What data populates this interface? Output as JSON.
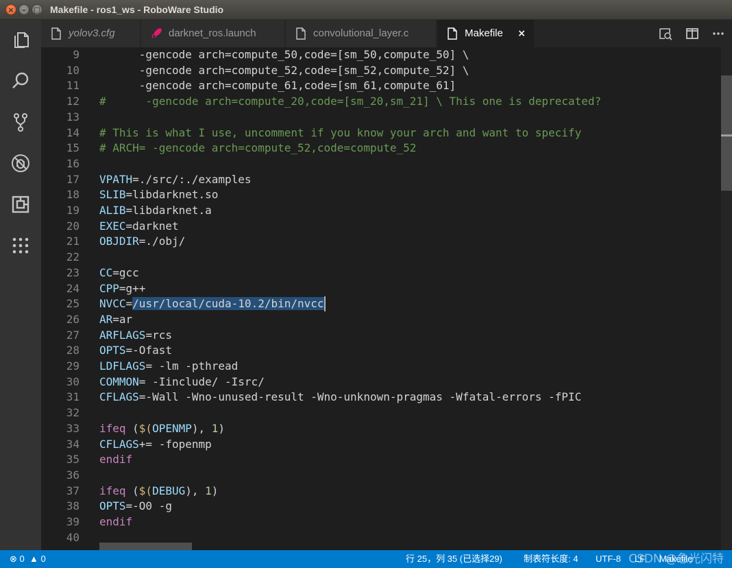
{
  "window": {
    "title": "Makefile - ros1_ws - RoboWare Studio",
    "close_glyph": "×",
    "min_glyph": "–",
    "max_glyph": "□"
  },
  "activity_icons": [
    "files-icon",
    "search-icon",
    "source-control-icon",
    "debug-icon",
    "extensions-icon",
    "apps-icon"
  ],
  "tabs": [
    {
      "label": "yolov3.cfg",
      "icon": "file-icon",
      "italic": true
    },
    {
      "label": "darknet_ros.launch",
      "icon": "rocket-icon",
      "italic": false
    },
    {
      "label": "convolutional_layer.c",
      "icon": "file-icon",
      "italic": false
    },
    {
      "label": "Makefile",
      "icon": "file-icon",
      "italic": false,
      "active": true,
      "close": "×"
    }
  ],
  "tab_actions": [
    "open-preview-icon",
    "split-editor-icon",
    "more-actions-icon"
  ],
  "editor": {
    "lines": [
      {
        "n": "9",
        "tokens": [
          [
            "      -gencode arch=compute_50,code=[sm_50,compute_50] \\",
            ""
          ]
        ]
      },
      {
        "n": "10",
        "tokens": [
          [
            "      -gencode arch=compute_52,code=[sm_52,compute_52] \\",
            ""
          ]
        ]
      },
      {
        "n": "11",
        "tokens": [
          [
            "      -gencode arch=compute_61,code=[sm_61,compute_61]",
            ""
          ]
        ]
      },
      {
        "n": "12",
        "tokens": [
          [
            "#      -gencode arch=compute_20,code=[sm_20,sm_21] \\ This one is deprecated?",
            "cmt"
          ]
        ]
      },
      {
        "n": "13",
        "tokens": []
      },
      {
        "n": "14",
        "tokens": [
          [
            "# This is what I use, uncomment if you know your arch and want to specify",
            "cmt"
          ]
        ]
      },
      {
        "n": "15",
        "tokens": [
          [
            "# ARCH= -gencode arch=compute_52,code=compute_52",
            "cmt"
          ]
        ]
      },
      {
        "n": "16",
        "tokens": []
      },
      {
        "n": "17",
        "tokens": [
          [
            "VPATH",
            "var"
          ],
          [
            "=./src/:./examples",
            ""
          ]
        ]
      },
      {
        "n": "18",
        "tokens": [
          [
            "SLIB",
            "var"
          ],
          [
            "=libdarknet.so",
            ""
          ]
        ]
      },
      {
        "n": "19",
        "tokens": [
          [
            "ALIB",
            "var"
          ],
          [
            "=libdarknet.a",
            ""
          ]
        ]
      },
      {
        "n": "20",
        "tokens": [
          [
            "EXEC",
            "var"
          ],
          [
            "=darknet",
            ""
          ]
        ]
      },
      {
        "n": "21",
        "tokens": [
          [
            "OBJDIR",
            "var"
          ],
          [
            "=./obj/",
            ""
          ]
        ]
      },
      {
        "n": "22",
        "tokens": []
      },
      {
        "n": "23",
        "tokens": [
          [
            "CC",
            "var"
          ],
          [
            "=gcc",
            ""
          ]
        ]
      },
      {
        "n": "24",
        "tokens": [
          [
            "CPP",
            "var"
          ],
          [
            "=g++",
            ""
          ]
        ]
      },
      {
        "n": "25",
        "tokens": [
          [
            "NVCC",
            "var"
          ],
          [
            "=",
            ""
          ],
          [
            "/usr/local/cuda-10.2/bin/nvcc",
            "sel"
          ]
        ],
        "cursor": true
      },
      {
        "n": "26",
        "tokens": [
          [
            "AR",
            "var"
          ],
          [
            "=ar",
            ""
          ]
        ]
      },
      {
        "n": "27",
        "tokens": [
          [
            "ARFLAGS",
            "var"
          ],
          [
            "=rcs",
            ""
          ]
        ]
      },
      {
        "n": "28",
        "tokens": [
          [
            "OPTS",
            "var"
          ],
          [
            "=-Ofast",
            ""
          ]
        ]
      },
      {
        "n": "29",
        "tokens": [
          [
            "LDFLAGS",
            "var"
          ],
          [
            "= -lm -pthread",
            ""
          ]
        ]
      },
      {
        "n": "30",
        "tokens": [
          [
            "COMMON",
            "var"
          ],
          [
            "= -Iinclude/ -Isrc/",
            ""
          ]
        ]
      },
      {
        "n": "31",
        "tokens": [
          [
            "CFLAGS",
            "var"
          ],
          [
            "=-Wall -Wno-unused-result -Wno-unknown-pragmas -Wfatal-errors -fPIC",
            ""
          ]
        ]
      },
      {
        "n": "32",
        "tokens": []
      },
      {
        "n": "33",
        "tokens": [
          [
            "ifeq",
            "kw"
          ],
          [
            " (",
            ""
          ],
          [
            "$(",
            "sym"
          ],
          [
            "OPENMP",
            "var"
          ],
          [
            "), ",
            ""
          ],
          [
            "1",
            "num"
          ],
          [
            ")",
            ""
          ]
        ]
      },
      {
        "n": "34",
        "tokens": [
          [
            "CFLAGS",
            "var"
          ],
          [
            "+= -fopenmp",
            ""
          ]
        ]
      },
      {
        "n": "35",
        "tokens": [
          [
            "endif",
            "kw"
          ]
        ]
      },
      {
        "n": "36",
        "tokens": []
      },
      {
        "n": "37",
        "tokens": [
          [
            "ifeq",
            "kw"
          ],
          [
            " (",
            ""
          ],
          [
            "$(",
            "sym"
          ],
          [
            "DEBUG",
            "var"
          ],
          [
            "), ",
            ""
          ],
          [
            "1",
            "num"
          ],
          [
            ")",
            ""
          ]
        ]
      },
      {
        "n": "38",
        "tokens": [
          [
            "OPTS",
            "var"
          ],
          [
            "=-O0 -g",
            ""
          ]
        ]
      },
      {
        "n": "39",
        "tokens": [
          [
            "endif",
            "kw"
          ]
        ]
      },
      {
        "n": "40",
        "tokens": []
      }
    ]
  },
  "status": {
    "errors": "0",
    "warnings": "0",
    "position": "行 25，列 35 (已选择29)",
    "tab_size": "制表符长度: 4",
    "encoding": "UTF-8",
    "eol": "LF",
    "language": "Makefile",
    "watermark": "CSDN @急光闪特"
  },
  "colors": {
    "statusbar": "#007acc",
    "activitybar": "#333333",
    "editor_bg": "#1e1e1e",
    "variable": "#9cdcfe",
    "comment": "#6a9955",
    "keyword": "#c586c0",
    "selection": "#264f78"
  }
}
